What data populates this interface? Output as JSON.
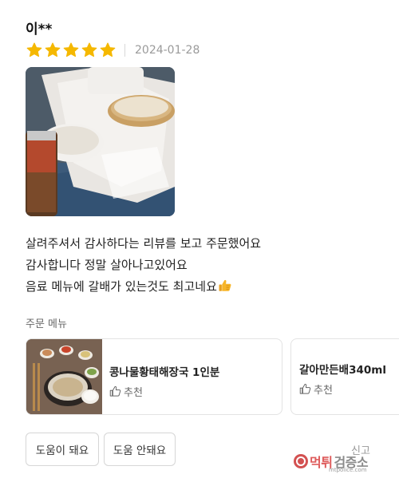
{
  "review": {
    "reviewer": "이**",
    "rating": 5,
    "rating_max": 5,
    "star_color": "#f5b800",
    "date": "2024-01-28",
    "photo_icon": "food-photo",
    "text_lines": [
      "살려주셔서 감사하다는 리뷰를 보고 주문했어요",
      "감사합니다 정말 살아나고있어요",
      "음료 메뉴에 갈배가 있는것도 최고네요"
    ],
    "emoji_icon": "thumbs-up-emoji"
  },
  "order_menu": {
    "heading": "주문 메뉴",
    "items": [
      {
        "name": "콩나물황태해장국 1인분",
        "recommend_label": "추천",
        "has_image": true
      },
      {
        "name": "갈아만든배340ml",
        "recommend_label": "추천",
        "has_image": false
      }
    ]
  },
  "actions": {
    "helpful_label": "도움이 돼요",
    "not_helpful_label": "도움 안돼요",
    "report_label": "신고"
  },
  "watermark": {
    "text_red": "먹튀",
    "text_gray": "검증소",
    "sub": "mtpolice.com"
  }
}
